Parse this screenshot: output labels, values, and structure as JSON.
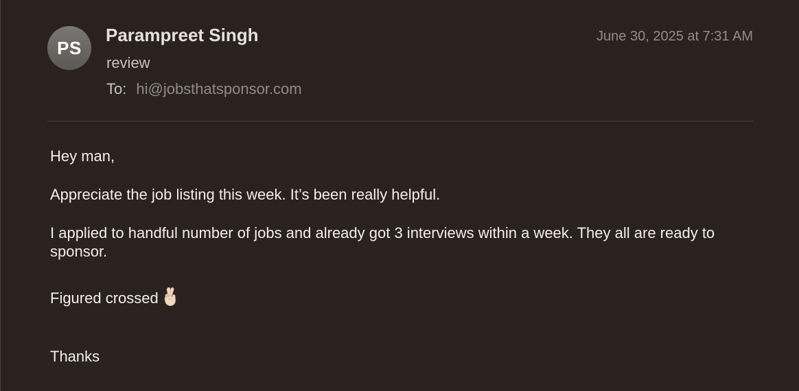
{
  "message": {
    "avatar_initials": "PS",
    "sender_name": "Parampreet Singh",
    "subject": "review",
    "to_label": "To:",
    "to_address": "hi@jobsthatsponsor.com",
    "date": "June 30, 2025 at 7:31 AM"
  },
  "body": {
    "greeting": "Hey man,",
    "paragraph_1": "Appreciate the job listing this week. It’s been really helpful.",
    "paragraph_2": "I applied to handful number of jobs and already got 3 interviews within a week. They all are ready to sponsor.",
    "paragraph_3": "Figured crossed",
    "paragraph_3_emoji": "crossed-fingers-icon",
    "signoff": "Thanks"
  }
}
